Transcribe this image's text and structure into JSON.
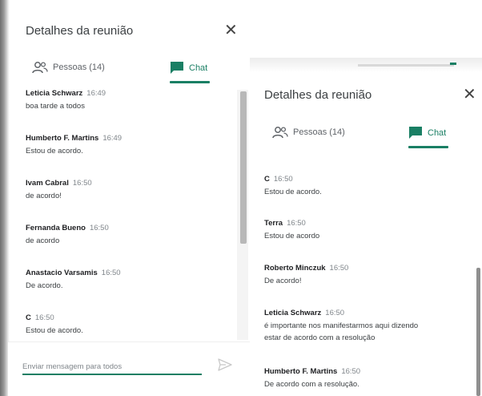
{
  "left_panel": {
    "title": "Detalhes da reunião",
    "close_symbol": "✕",
    "tabs": [
      {
        "label": "Pessoas (14)",
        "icon": "people-icon"
      },
      {
        "label": "Chat",
        "icon": "chat-icon",
        "active": true
      }
    ],
    "messages": [
      {
        "name": "Leticia Schwarz",
        "time": "16:49",
        "text": "boa tarde a todos"
      },
      {
        "name": "Humberto F. Martins",
        "time": "16:49",
        "text": "Estou de acordo."
      },
      {
        "name": "Ivam Cabral",
        "time": "16:50",
        "text": "de acordo!"
      },
      {
        "name": "Fernanda Bueno",
        "time": "16:50",
        "text": "de acordo"
      },
      {
        "name": "Anastacio Varsamis",
        "time": "16:50",
        "text": "De acordo."
      },
      {
        "name": "C",
        "time": "16:50",
        "text": "Estou de acordo."
      }
    ],
    "input_placeholder": "Enviar mensagem para todos",
    "send_icon": "send-icon"
  },
  "right_panel": {
    "title": "Detalhes da reunião",
    "close_symbol": "✕",
    "tabs": [
      {
        "label": "Pessoas (14)",
        "icon": "people-icon"
      },
      {
        "label": "Chat",
        "icon": "chat-icon",
        "active": true
      }
    ],
    "messages": [
      {
        "name": "C",
        "time": "16:50",
        "lines": [
          "Estou de acordo."
        ]
      },
      {
        "name": "Terra",
        "time": "16:50",
        "lines": [
          "Estou de acordo"
        ]
      },
      {
        "name": "Roberto Minczuk",
        "time": "16:50",
        "lines": [
          "De acordo!"
        ]
      },
      {
        "name": "Leticia Schwarz",
        "time": "16:50",
        "lines": [
          "é importante nos manifestarmos aqui dizendo",
          "estar de acordo com a resolução"
        ]
      },
      {
        "name": "Humberto F. Martins",
        "time": "16:50",
        "lines": [
          "De acordo com a resolução."
        ]
      }
    ]
  },
  "colors": {
    "accent": "#1a7f64",
    "text": "#202124",
    "muted": "#80868b"
  }
}
